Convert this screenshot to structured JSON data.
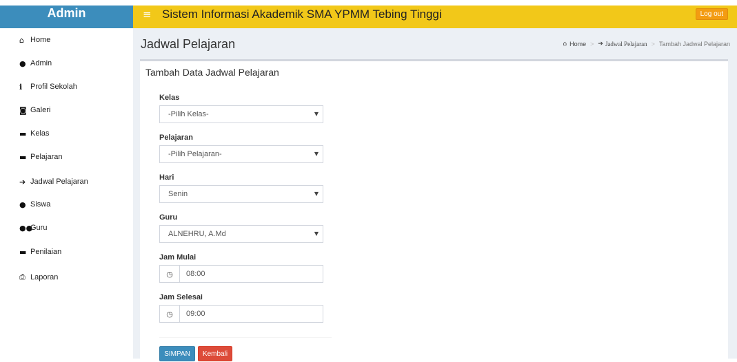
{
  "brand": {
    "title": "Admin"
  },
  "header": {
    "title": "Sistem Informasi Akademik SMA YPMM Tebing Tinggi",
    "logout_label": "Log out",
    "menu_icon": "hamburger-icon"
  },
  "sidebar": {
    "items": [
      {
        "label": "Home",
        "icon": "home-icon"
      },
      {
        "label": "Admin",
        "icon": "user-icon"
      },
      {
        "label": "Profil Sekolah",
        "icon": "info-icon"
      },
      {
        "label": "Galeri",
        "icon": "camera-icon"
      },
      {
        "label": "Kelas",
        "icon": "briefcase-icon"
      },
      {
        "label": "Pelajaran",
        "icon": "briefcase-icon"
      },
      {
        "label": "Jadwal Pelajaran",
        "icon": "arrow-right-icon"
      },
      {
        "label": "Siswa",
        "icon": "user-icon"
      },
      {
        "label": "Guru",
        "icon": "users-icon"
      },
      {
        "label": "Penilaian",
        "icon": "briefcase-icon"
      },
      {
        "label": "Laporan",
        "icon": "print-icon"
      }
    ]
  },
  "page": {
    "title": "Jadwal Pelajaran",
    "breadcrumb": {
      "home": "Home",
      "parent": "Jadwal Pelajaran",
      "current": "Tambah Jadwal Pelajaran"
    }
  },
  "form": {
    "title": "Tambah Data Jadwal Pelajaran",
    "kelas": {
      "label": "Kelas",
      "value": "-Pilih Kelas-"
    },
    "pelajaran": {
      "label": "Pelajaran",
      "value": "-Pilih Pelajaran-"
    },
    "hari": {
      "label": "Hari",
      "value": "Senin"
    },
    "guru": {
      "label": "Guru",
      "value": "ALNEHRU, A.Md"
    },
    "jam_mulai": {
      "label": "Jam Mulai",
      "value": "08:00"
    },
    "jam_selesai": {
      "label": "Jam Selesai",
      "value": "09:00"
    },
    "save_label": "SIMPAN",
    "back_label": "Kembali"
  },
  "colors": {
    "brand": "#3c8dbc",
    "header": "#f2c819",
    "save": "#3c8dbc",
    "back": "#dd4b39",
    "logout": "#f39c12"
  }
}
